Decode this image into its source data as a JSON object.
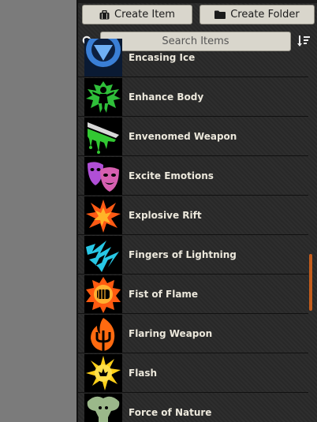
{
  "toolbar": {
    "create_item_label": "Create Item",
    "create_folder_label": "Create Folder"
  },
  "search": {
    "placeholder": "Search Items"
  },
  "items": [
    {
      "label": "Encasing Ice",
      "icon": "ice-icon"
    },
    {
      "label": "Enhance Body",
      "icon": "body-aura-icon"
    },
    {
      "label": "Envenomed Weapon",
      "icon": "poison-blade-icon"
    },
    {
      "label": "Excite Emotions",
      "icon": "masks-icon"
    },
    {
      "label": "Explosive Rift",
      "icon": "explosion-icon"
    },
    {
      "label": "Fingers of Lightning",
      "icon": "lightning-icon"
    },
    {
      "label": "Fist of Flame",
      "icon": "flame-fist-icon"
    },
    {
      "label": "Flaring Weapon",
      "icon": "flaming-trident-icon"
    },
    {
      "label": "Flash",
      "icon": "flash-icon"
    },
    {
      "label": "Force of Nature",
      "icon": "tree-icon"
    }
  ],
  "colors": {
    "panel_bg": "#2b2b2b",
    "button_bg": "#d9d6cc",
    "scrollbar_accent": "#c35c1c",
    "label_text": "#ece8dc"
  }
}
